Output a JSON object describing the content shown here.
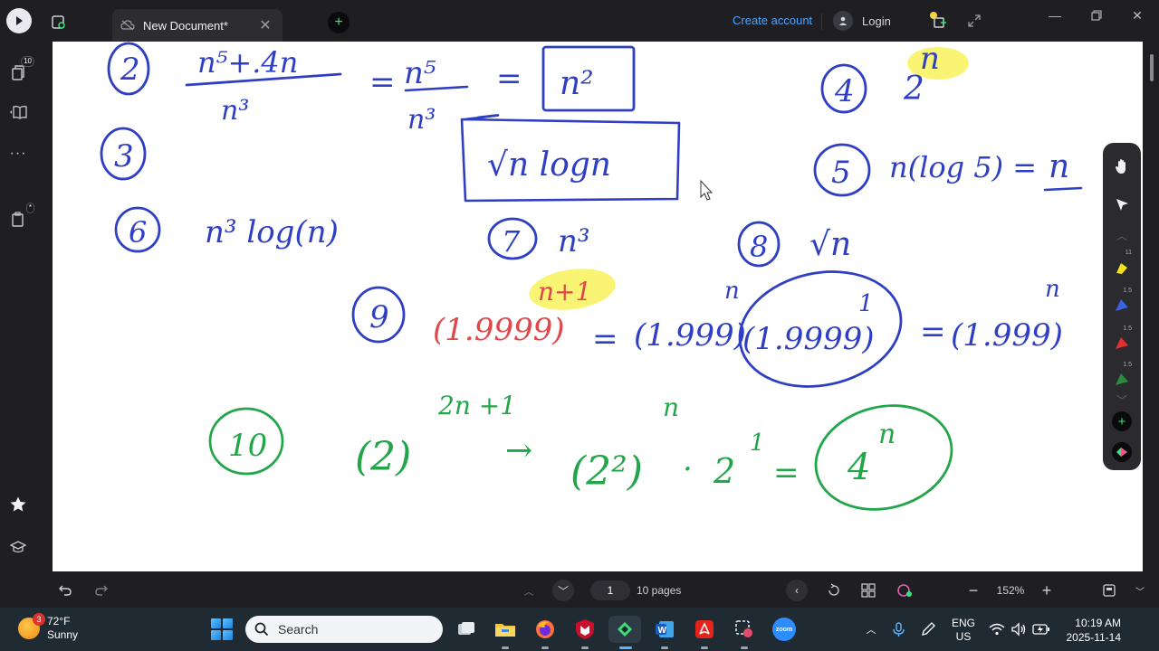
{
  "titlebar": {
    "tab_title": "New Document*",
    "create_account": "Create account",
    "login": "Login"
  },
  "leftrail": {
    "pages_badge": "10",
    "bookmark_badge": "*"
  },
  "canvas": {
    "items": {
      "q2_num": "2",
      "q2_top": "n⁵+.4n",
      "q2_bottom": "n³",
      "q2_eq1": "=",
      "q2_mid_top": "n⁵",
      "q2_mid_bottom": "n³",
      "q2_eq2": "=",
      "q2_ans": "n²",
      "q3_num": "3",
      "q3_ans": "√n logn",
      "q4_num": "4",
      "q4_base": "2",
      "q4_exp": "n",
      "q5_num": "5",
      "q5_expr": "n(log 5) =",
      "q5_ans": "n",
      "q6_num": "6",
      "q6_expr": "n³ log(n)",
      "q7_num": "7",
      "q7_expr": "n³",
      "q8_num": "8",
      "q8_expr": "√n",
      "q9_num": "9",
      "q9_base": "(1.9999)",
      "q9_exp": "n+1",
      "q9_eq1": "=",
      "q9_p1": "(1.999)",
      "q9_p1_exp": "n",
      "q9_p2": "(1.9999)",
      "q9_p2_exp": "1",
      "q9_eq2": "=",
      "q9_ans": "(1.999)",
      "q9_ans_exp": "n",
      "q10_num": "10",
      "q10_base": "(2)",
      "q10_exp": "2n +1",
      "q10_arrow": "→",
      "q10_p1": "(2²)",
      "q10_p1_exp": "n",
      "q10_dot": "·",
      "q10_p2": "2",
      "q10_p2_exp": "1",
      "q10_eq": "=",
      "q10_ans": "4",
      "q10_ans_exp": "n"
    }
  },
  "pentool": {
    "sizes": [
      "1.5",
      "1.5",
      "1.5"
    ],
    "top_size": "11"
  },
  "bottombar": {
    "page_number": "1",
    "page_count": "10 pages",
    "zoom": "152%"
  },
  "taskbar": {
    "weather_badge": "3",
    "temperature": "72°F",
    "condition": "Sunny",
    "search_placeholder": "Search",
    "lang1": "ENG",
    "lang2": "US",
    "time": "10:19 AM",
    "date": "2025-11-14"
  },
  "colors": {
    "ink_blue": "#2f3fc4",
    "ink_red": "#e0474a",
    "ink_green": "#23a64a",
    "highlight_yellow": "#f8f25a",
    "accent_green": "#3ee07a",
    "link_blue": "#4aa3ff"
  }
}
